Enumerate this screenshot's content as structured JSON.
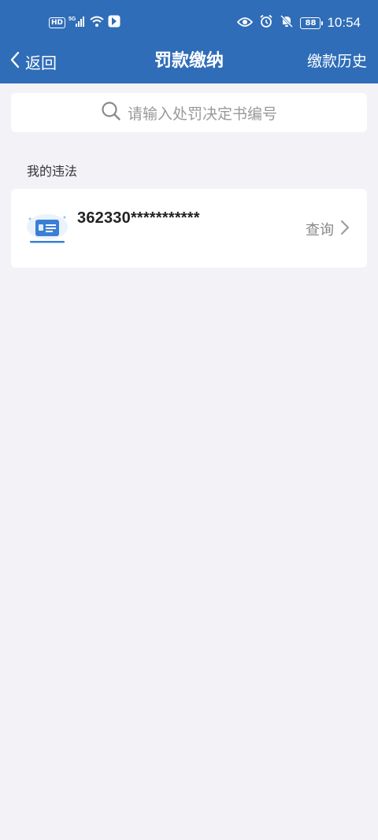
{
  "colors": {
    "header_bg": "#2f6db8",
    "page_bg": "#f2f2f7",
    "card_bg": "#ffffff",
    "muted_text": "#888888"
  },
  "status_bar": {
    "hd_label": "HD",
    "network_label": "5G",
    "battery_level": "88",
    "time": "10:54",
    "icons": [
      "hd-icon",
      "signal-icon",
      "wifi-icon",
      "app-notification-icon",
      "eye-icon",
      "alarm-icon",
      "mute-bell-icon",
      "battery-icon"
    ]
  },
  "nav": {
    "back_label": "返回",
    "title": "罚款缴纳",
    "history_label": "缴款历史"
  },
  "search": {
    "placeholder": "请输入处罚决定书编号",
    "icon": "search-icon"
  },
  "section": {
    "label": "我的违法"
  },
  "violations": [
    {
      "number": "362330***********",
      "action_label": "查询",
      "icon": "id-card-icon"
    }
  ]
}
